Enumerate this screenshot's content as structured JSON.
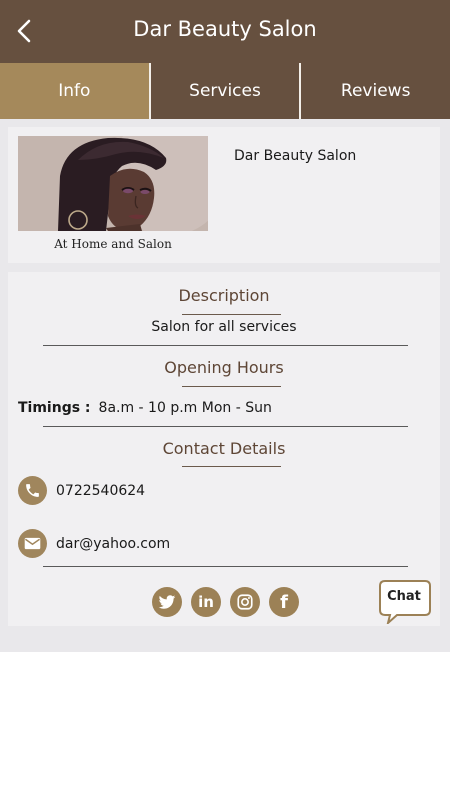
{
  "header": {
    "title": "Dar Beauty Salon"
  },
  "tabs": [
    {
      "label": "Info",
      "active": true
    },
    {
      "label": "Services",
      "active": false
    },
    {
      "label": "Reviews",
      "active": false
    }
  ],
  "profile": {
    "name": "Dar Beauty Salon",
    "caption": "At Home and Salon"
  },
  "description": {
    "heading": "Description",
    "text": "Salon for all services"
  },
  "hours": {
    "heading": "Opening Hours",
    "label": "Timings :",
    "value": "8a.m - 10 p.m Mon - Sun"
  },
  "contact": {
    "heading": "Contact Details",
    "phone": "0722540624",
    "email": "dar@yahoo.com"
  },
  "socials": [
    {
      "icon": "twitter-icon"
    },
    {
      "icon": "linkedin-icon",
      "glyph": "in"
    },
    {
      "icon": "instagram-icon"
    },
    {
      "icon": "facebook-icon",
      "glyph": "f"
    }
  ],
  "chat": {
    "label": "Chat"
  },
  "colors": {
    "header_brown": "#66503f",
    "accent_gold": "#a5895b",
    "icon_gold": "#a0865d",
    "heading_brown": "#5e4636"
  }
}
